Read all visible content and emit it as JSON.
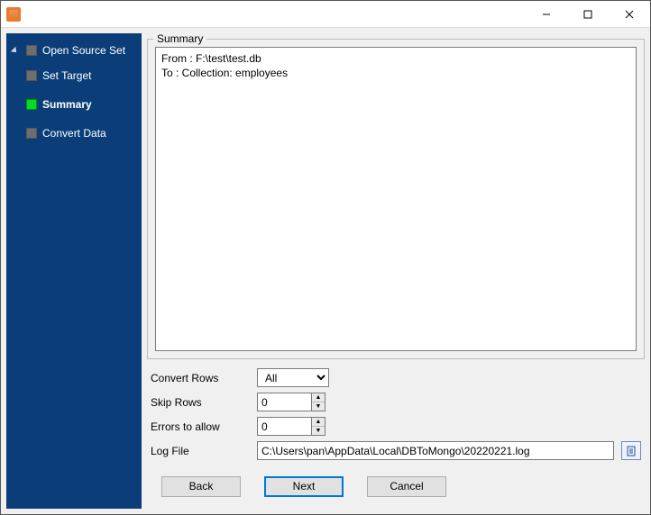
{
  "sidebar": {
    "root": "Open Source Set",
    "items": [
      {
        "label": "Set Target",
        "active": false
      },
      {
        "label": "Summary",
        "active": true
      },
      {
        "label": "Convert Data",
        "active": false
      }
    ]
  },
  "summary": {
    "title": "Summary",
    "from_line": "From : F:\\test\\test.db",
    "to_line": "To : Collection: employees"
  },
  "form": {
    "convert_rows_label": "Convert Rows",
    "convert_rows_value": "All",
    "skip_rows_label": "Skip Rows",
    "skip_rows_value": "0",
    "errors_label": "Errors to allow",
    "errors_value": "0",
    "log_label": "Log File",
    "log_value": "C:\\Users\\pan\\AppData\\Local\\DBToMongo\\20220221.log"
  },
  "buttons": {
    "back": "Back",
    "next": "Next",
    "cancel": "Cancel"
  }
}
